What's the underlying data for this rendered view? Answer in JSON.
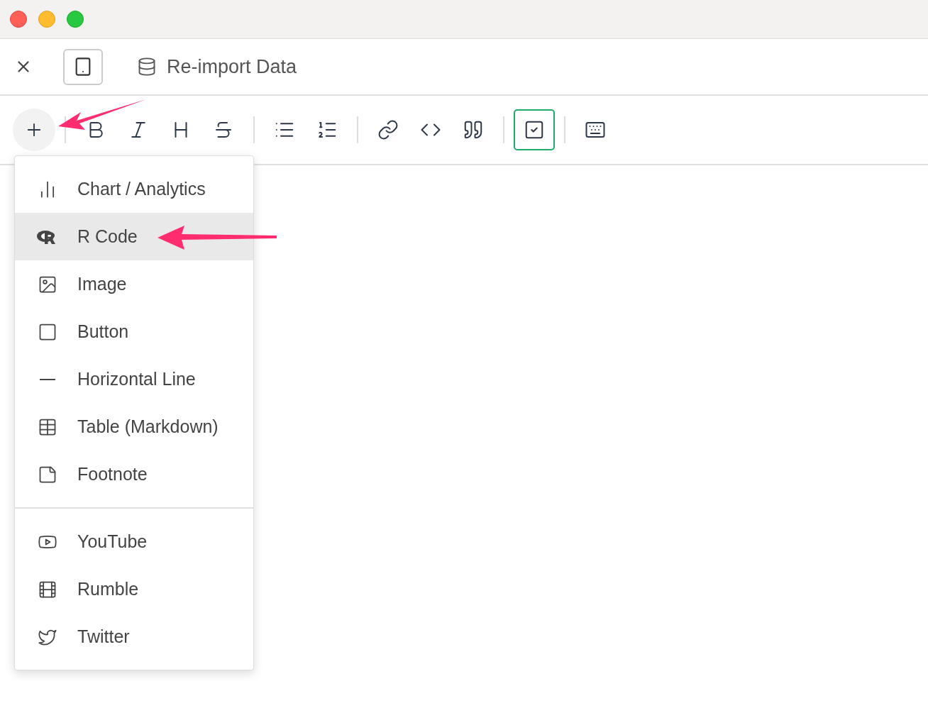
{
  "header": {
    "title": "Re-import Data"
  },
  "toolbar": {
    "groups": [
      [
        {
          "kind": "plus",
          "selected": true
        }
      ],
      [
        {
          "kind": "bold",
          "selected": false
        },
        {
          "kind": "italic",
          "selected": false
        },
        {
          "kind": "heading",
          "selected": false
        },
        {
          "kind": "strike",
          "selected": false
        }
      ],
      [
        {
          "kind": "bullet-list",
          "selected": false
        },
        {
          "kind": "numbered-list",
          "selected": false
        }
      ],
      [
        {
          "kind": "link",
          "selected": false
        },
        {
          "kind": "code",
          "selected": false
        },
        {
          "kind": "quote",
          "selected": false
        }
      ],
      [
        {
          "kind": "task",
          "selected": true
        }
      ],
      [
        {
          "kind": "keyboard",
          "selected": false
        }
      ]
    ]
  },
  "menu": {
    "sections": [
      [
        {
          "kind": "chart",
          "label": "Chart / Analytics",
          "selected": false
        },
        {
          "kind": "r",
          "label": "R Code",
          "selected": true
        },
        {
          "kind": "image",
          "label": "Image",
          "selected": false
        },
        {
          "kind": "button",
          "label": "Button",
          "selected": false
        },
        {
          "kind": "line",
          "label": "Horizontal Line",
          "selected": false
        },
        {
          "kind": "table",
          "label": "Table (Markdown)",
          "selected": false
        },
        {
          "kind": "footnote",
          "label": "Footnote",
          "selected": false
        }
      ],
      [
        {
          "kind": "youtube",
          "label": "YouTube",
          "selected": false
        },
        {
          "kind": "film",
          "label": "Rumble",
          "selected": false
        },
        {
          "kind": "twitter",
          "label": "Twitter",
          "selected": false
        }
      ]
    ]
  }
}
